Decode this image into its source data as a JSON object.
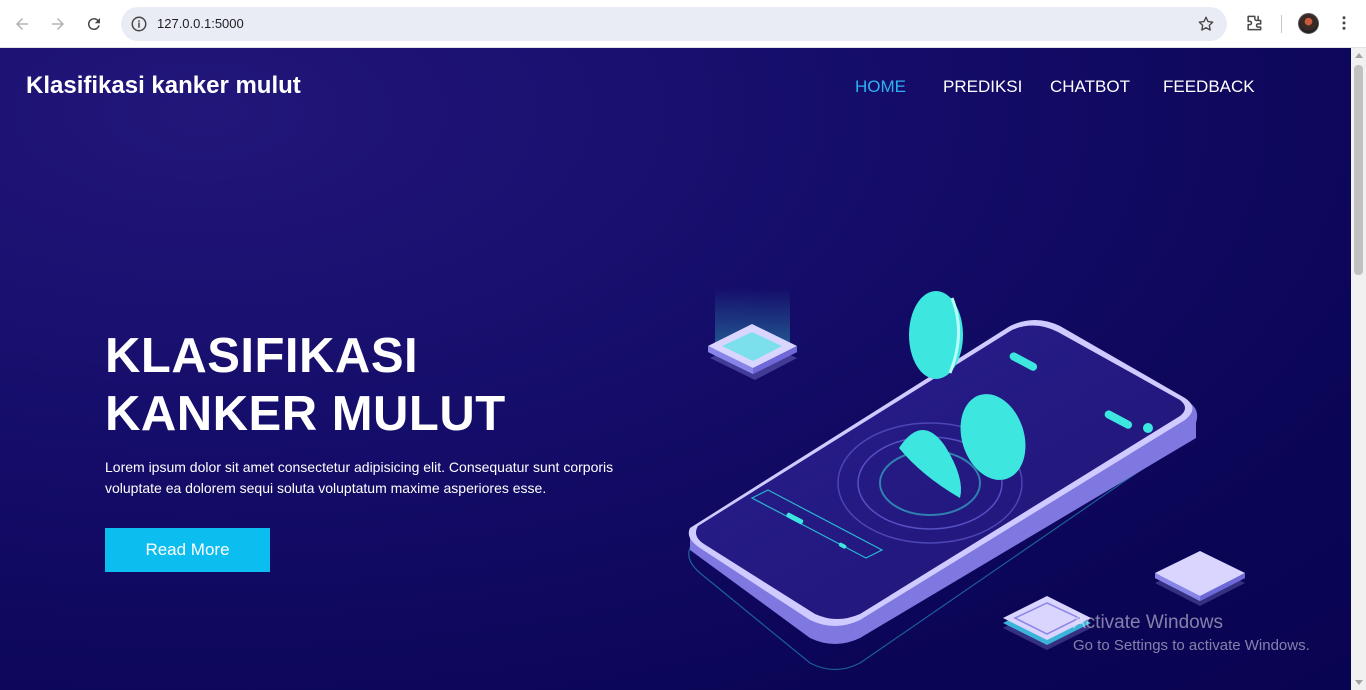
{
  "browser": {
    "url": "127.0.0.1:5000",
    "icons": [
      "back-arrow-icon",
      "forward-arrow-icon",
      "reload-icon",
      "site-info-icon",
      "bookmark-star-icon",
      "extensions-puzzle-icon",
      "profile-avatar",
      "kebab-menu-icon"
    ]
  },
  "header": {
    "brand": "Klasifikasi kanker mulut",
    "nav": [
      {
        "label": "HOME",
        "active": true
      },
      {
        "label": "PREDIKSI",
        "active": false
      },
      {
        "label": "CHATBOT",
        "active": false
      },
      {
        "label": "FEEDBACK",
        "active": false
      }
    ]
  },
  "hero": {
    "title_line1": "KLASIFIKASI",
    "title_line2": "KANKER MULUT",
    "description": "Lorem ipsum dolor sit amet consectetur adipisicing elit. Consequatur sunt corporis voluptate ea dolorem sequi soluta voluptatum maxime asperiores esse.",
    "button": "Read More"
  },
  "watermark": {
    "line1": "Activate Windows",
    "line2": "Go to Settings to activate Windows."
  },
  "colors": {
    "page_bg": "#110a62",
    "accent": "#0cbdf0",
    "active_nav": "#2fb1f2",
    "teal": "#3ee6e0"
  }
}
